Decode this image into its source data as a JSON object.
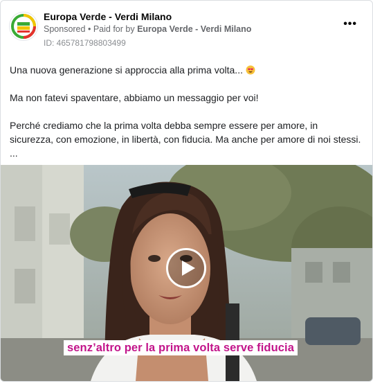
{
  "post": {
    "page_name": "Europa Verde - Verdi Milano",
    "sponsored_label": "Sponsored",
    "separator": "•",
    "paid_for_prefix": "Paid for by",
    "paid_for_by": "Europa Verde - Verdi Milano",
    "ad_id": "ID: 465781798803499",
    "more_icon": "more-horizontal-icon",
    "more_label": "•••"
  },
  "body": {
    "line1": "Una nuova generazione si approccia alla prima volta...",
    "line1_emoji": "smiling-face-with-heart-eyes",
    "line2": "Ma non fatevi spaventare, abbiamo un messaggio per voi!",
    "line3": "Perché crediamo che la prima volta debba sempre essere per amore, in sicurezza, con emozione, in libertà, con fiducia. Ma anche per amore di noi stessi.",
    "ellipsis": "..."
  },
  "video": {
    "caption": "senz’altro per la prima volta serve fiducia",
    "play_icon": "play-icon",
    "caption_color": "#c2148a"
  }
}
